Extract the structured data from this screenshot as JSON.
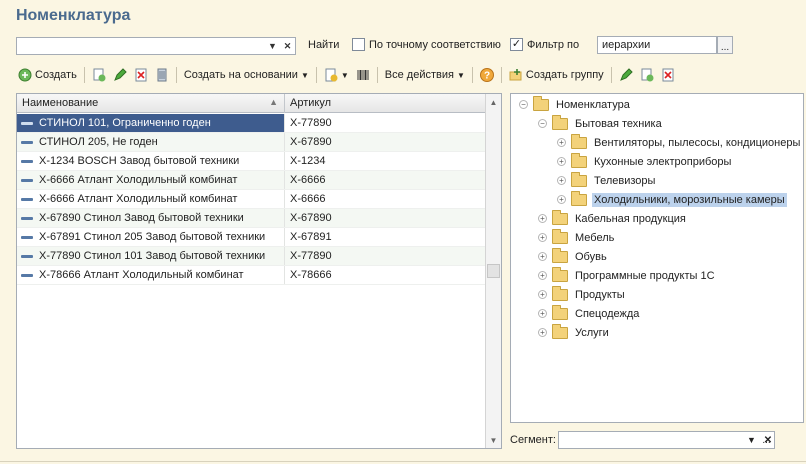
{
  "window": {
    "title": "Номенклатура"
  },
  "search": {
    "value": "",
    "find_label": "Найти",
    "exact_match_label": "По точному соответствию",
    "exact_match_checked": false,
    "filter_label": "Фильтр по",
    "filter_checked": true,
    "filter_value": "иерархии"
  },
  "toolbar": {
    "create_label": "Создать",
    "create_based_label": "Создать на основании",
    "all_actions_label": "Все действия",
    "create_group_label": "Создать группу"
  },
  "table": {
    "columns": [
      "Наименование",
      "Артикул"
    ],
    "rows": [
      {
        "name": "СТИНОЛ 101, Ограниченно годен",
        "sku": "Х-77890",
        "selected": true
      },
      {
        "name": "СТИНОЛ 205, Не годен",
        "sku": "Х-67890",
        "selected": false
      },
      {
        "name": "Х-1234 BOSCH Завод бытовой техники",
        "sku": "Х-1234",
        "selected": false
      },
      {
        "name": "Х-6666 Атлант Холодильный комбинат",
        "sku": "Х-6666",
        "selected": false
      },
      {
        "name": "Х-6666 Атлант Холодильный комбинат",
        "sku": "Х-6666",
        "selected": false
      },
      {
        "name": "Х-67890 Стинол Завод бытовой техники",
        "sku": "Х-67890",
        "selected": false
      },
      {
        "name": "Х-67891 Стинол 205 Завод бытовой техники",
        "sku": "Х-67891",
        "selected": false
      },
      {
        "name": "Х-77890 Стинол 101 Завод бытовой техники",
        "sku": "Х-77890",
        "selected": false
      },
      {
        "name": "Х-78666 Атлант Холодильный комбинат",
        "sku": "Х-78666",
        "selected": false
      }
    ]
  },
  "tree": {
    "nodes": [
      {
        "label": "Номенклатура",
        "level": 0,
        "expander": "minus",
        "selected": false
      },
      {
        "label": "Бытовая техника",
        "level": 1,
        "expander": "minus",
        "selected": false
      },
      {
        "label": "Вентиляторы, пылесосы, кондиционеры",
        "level": 2,
        "expander": "plus",
        "selected": false
      },
      {
        "label": "Кухонные электроприборы",
        "level": 2,
        "expander": "plus",
        "selected": false
      },
      {
        "label": "Телевизоры",
        "level": 2,
        "expander": "plus",
        "selected": false
      },
      {
        "label": "Холодильники, морозильные камеры",
        "level": 2,
        "expander": "plus",
        "selected": true
      },
      {
        "label": "Кабельная продукция",
        "level": 1,
        "expander": "plus",
        "selected": false
      },
      {
        "label": "Мебель",
        "level": 1,
        "expander": "plus",
        "selected": false
      },
      {
        "label": "Обувь",
        "level": 1,
        "expander": "plus",
        "selected": false
      },
      {
        "label": "Программные продукты 1С",
        "level": 1,
        "expander": "plus",
        "selected": false
      },
      {
        "label": "Продукты",
        "level": 1,
        "expander": "plus",
        "selected": false
      },
      {
        "label": "Спецодежда",
        "level": 1,
        "expander": "plus",
        "selected": false
      },
      {
        "label": "Услуги",
        "level": 1,
        "expander": "plus",
        "selected": false
      }
    ]
  },
  "segment": {
    "label": "Сегмент:",
    "value": ""
  },
  "colors": {
    "accent": "#4a6a8e",
    "selection": "#3e5c8e",
    "tree_selection": "#bcd2ec",
    "background": "#fbf6e3"
  }
}
